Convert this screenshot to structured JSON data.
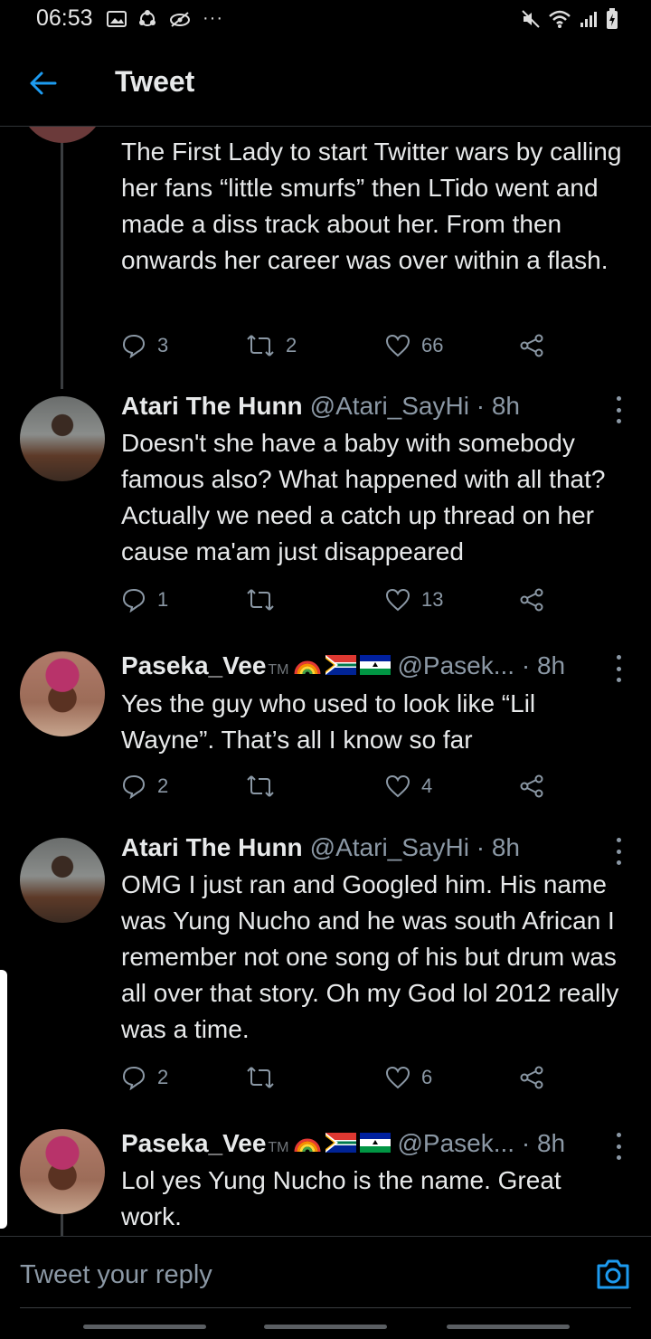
{
  "status_bar": {
    "time": "06:53"
  },
  "header": {
    "title": "Tweet"
  },
  "tweets": [
    {
      "text": "The First Lady to start Twitter wars by calling her fans “little smurfs” then LTido went and made a diss track about her. From then onwards her career was over within a flash.",
      "replies": "3",
      "retweets": "2",
      "likes": "66"
    },
    {
      "name": "Atari The Hunn",
      "tm": "",
      "handle": "@Atari_SayHi · 8h",
      "text": "Doesn't she have a baby with somebody famous also? What happened with all that? Actually we need a catch up thread on her cause ma'am just disappeared",
      "replies": "1",
      "retweets": "",
      "likes": "13"
    },
    {
      "name": "Paseka_Vee",
      "tm": "TM",
      "handle": "@Pasek... · 8h",
      "text": "Yes the guy who used to look like “Lil Wayne”. That’s all I know so far",
      "replies": "2",
      "retweets": "",
      "likes": "4"
    },
    {
      "name": "Atari The Hunn",
      "tm": "",
      "handle": "@Atari_SayHi · 8h",
      "text": "OMG I just ran and Googled him. His name was Yung Nucho and he was south African I remember not one song of his but drum was all over that story. Oh my God lol 2012 really was a time.",
      "replies": "2",
      "retweets": "",
      "likes": "6"
    },
    {
      "name": "Paseka_Vee",
      "tm": "TM",
      "handle": "@Pasek... · 8h",
      "text": "Lol yes Yung Nucho is the name. Great work."
    }
  ],
  "composer": {
    "placeholder": "Tweet your reply"
  },
  "colors": {
    "background": "#000000",
    "accent": "#1d9bf0",
    "secondary_text": "#8b98a5"
  }
}
